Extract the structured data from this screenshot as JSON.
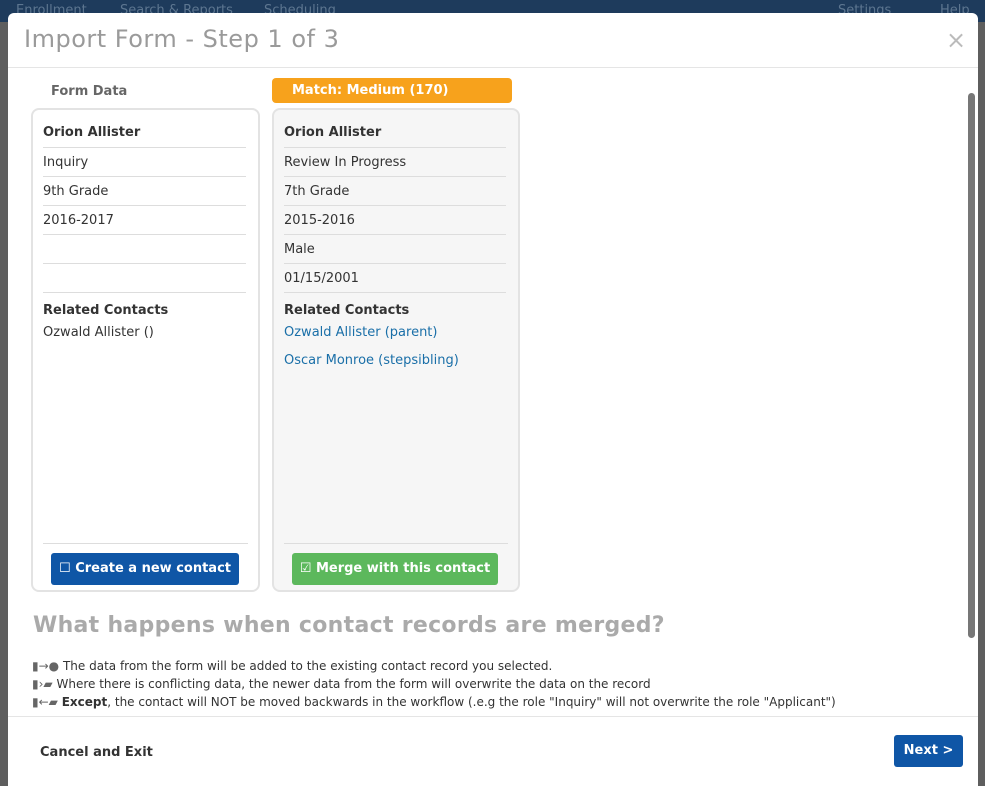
{
  "background_nav": {
    "items": [
      "Enrollment",
      "Search & Reports",
      "Scheduling"
    ],
    "settings": "Settings",
    "help": "Help"
  },
  "modal": {
    "title": "Import Form - Step 1 of 3",
    "close": "×"
  },
  "form_data": {
    "label": "Form Data",
    "name": "Orion Allister",
    "fields": [
      "Inquiry",
      "9th Grade",
      "2016-2017",
      "",
      ""
    ],
    "related_title": "Related Contacts",
    "related": [
      "Ozwald Allister ()"
    ],
    "button": "Create a new contact",
    "button_icon": "square-outline-icon"
  },
  "match": {
    "badge": "Match: Medium (170)",
    "badge_color": "#f7a21c",
    "name": "Orion Allister",
    "fields": [
      "Review In Progress",
      "7th Grade",
      "2015-2016",
      "Male",
      "01/15/2001"
    ],
    "related_title": "Related Contacts",
    "related": [
      "Ozwald Allister (parent)",
      "Oscar Monroe (stepsibling)"
    ],
    "button": "Merge with this contact",
    "button_icon": "check-square-icon"
  },
  "help": {
    "heading": "What happens when contact records are merged?",
    "lines": [
      {
        "text": "The data from the form will be added to the existing contact record you selected."
      },
      {
        "text": "Where there is conflicting data, the newer data from the form will overwrite the data on the record"
      },
      {
        "bold": "Except",
        "text": ", the contact will NOT be moved backwards in the workflow (.e.g the role \"Inquiry\" will not overwrite the role \"Applicant\")"
      }
    ]
  },
  "footer": {
    "cancel": "Cancel and Exit",
    "next": "Next >"
  },
  "colors": {
    "primary": "#0f56a6",
    "success": "#5cb85c",
    "link": "#1a6fa8"
  }
}
